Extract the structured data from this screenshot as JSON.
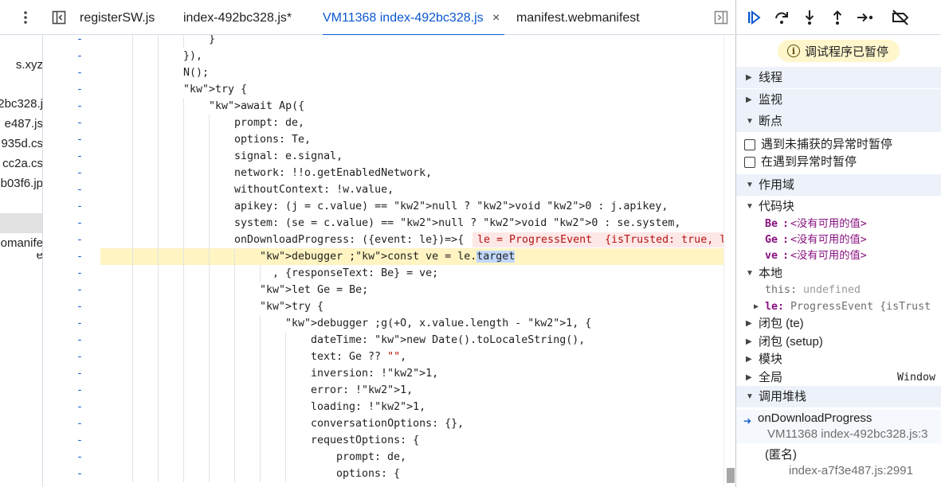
{
  "tabs": [
    {
      "label": "registerSW.js"
    },
    {
      "label": "index-492bc328.js*"
    },
    {
      "label": "VM11368 index-492bc328.js",
      "active": true
    },
    {
      "label": "manifest.webmanifest"
    }
  ],
  "tab_close": "×",
  "file_tree": [
    "s.xyz",
    "2bc328.j",
    "e487.js",
    "935d.cs",
    "cc2a.cs",
    "b03f6.jp",
    "",
    "omanife",
    "e"
  ],
  "code_lines": [
    {
      "gut": "-",
      "text": "}"
    },
    {
      "gut": "-",
      "text": "}),"
    },
    {
      "gut": "-",
      "text": "N();"
    },
    {
      "gut": "-",
      "text": "try {"
    },
    {
      "gut": "-",
      "text": "await Ap({"
    },
    {
      "gut": "-",
      "text": "prompt: de,"
    },
    {
      "gut": "-",
      "text": "options: Te,"
    },
    {
      "gut": "-",
      "text": "signal: e.signal,"
    },
    {
      "gut": "-",
      "text": "network: !!o.getEnabledNetwork,"
    },
    {
      "gut": "-",
      "text": "withoutContext: !w.value,"
    },
    {
      "gut": "-",
      "text": "apikey: (j = c.value) == null ? void 0 : j.apikey,"
    },
    {
      "gut": "-",
      "text": "system: (se = c.value) == null ? void 0 : se.system,"
    },
    {
      "gut": "-",
      "text": "onDownloadProgress: ({event: le})=>{"
    },
    {
      "gut": "-",
      "text": "debugger ;const ve = le.target"
    },
    {
      "gut": "-",
      "text": ", {responseText: Be} = ve;"
    },
    {
      "gut": "-",
      "text": "let Ge = Be;"
    },
    {
      "gut": "-",
      "text": "try {"
    },
    {
      "gut": "-",
      "text": "debugger ;g(+O, x.value.length - 1, {"
    },
    {
      "gut": "-",
      "text": "dateTime: new Date().toLocaleString(),"
    },
    {
      "gut": "-",
      "text": "text: Ge ?? \"\","
    },
    {
      "gut": "-",
      "text": "inversion: !1,"
    },
    {
      "gut": "-",
      "text": "error: !1,"
    },
    {
      "gut": "-",
      "text": "loading: !1,"
    },
    {
      "gut": "-",
      "text": "conversationOptions: {},"
    },
    {
      "gut": "-",
      "text": "requestOptions: {"
    },
    {
      "gut": "-",
      "text": "prompt: de,"
    },
    {
      "gut": "-",
      "text": "options: {"
    }
  ],
  "inline_value": "le = ProgressEvent  {isTrusted: true, l",
  "debugger": {
    "paused_text": "调试程序已暂停",
    "sections": {
      "threads": "线程",
      "watch": "监视",
      "breakpoints": "断点",
      "scope": "作用域",
      "call_stack": "调用堆栈"
    },
    "breakpoint_options": [
      {
        "label": "遇到未捕获的异常时暂停",
        "checked": false
      },
      {
        "label": "在遇到异常时暂停",
        "checked": false
      }
    ],
    "scope": {
      "block_label": "代码块",
      "block_vars": [
        {
          "name": "Be",
          "value": "<没有可用的值>"
        },
        {
          "name": "Ge",
          "value": "<没有可用的值>"
        },
        {
          "name": "ve",
          "value": "<没有可用的值>"
        }
      ],
      "local_label": "本地",
      "this_name": "this",
      "this_value": "undefined",
      "le_name": "le",
      "le_value": "ProgressEvent  {isTrust",
      "closure1": "闭包 (te)",
      "closure2": "闭包 (setup)",
      "module": "模块",
      "global": "全局",
      "global_value": "Window"
    },
    "call_stack": [
      {
        "name": "onDownloadProgress",
        "location": "VM11368 index-492bc328.js:3"
      },
      {
        "name": "(匿名)",
        "location": "index-a7f3e487.js:2991"
      }
    ]
  }
}
